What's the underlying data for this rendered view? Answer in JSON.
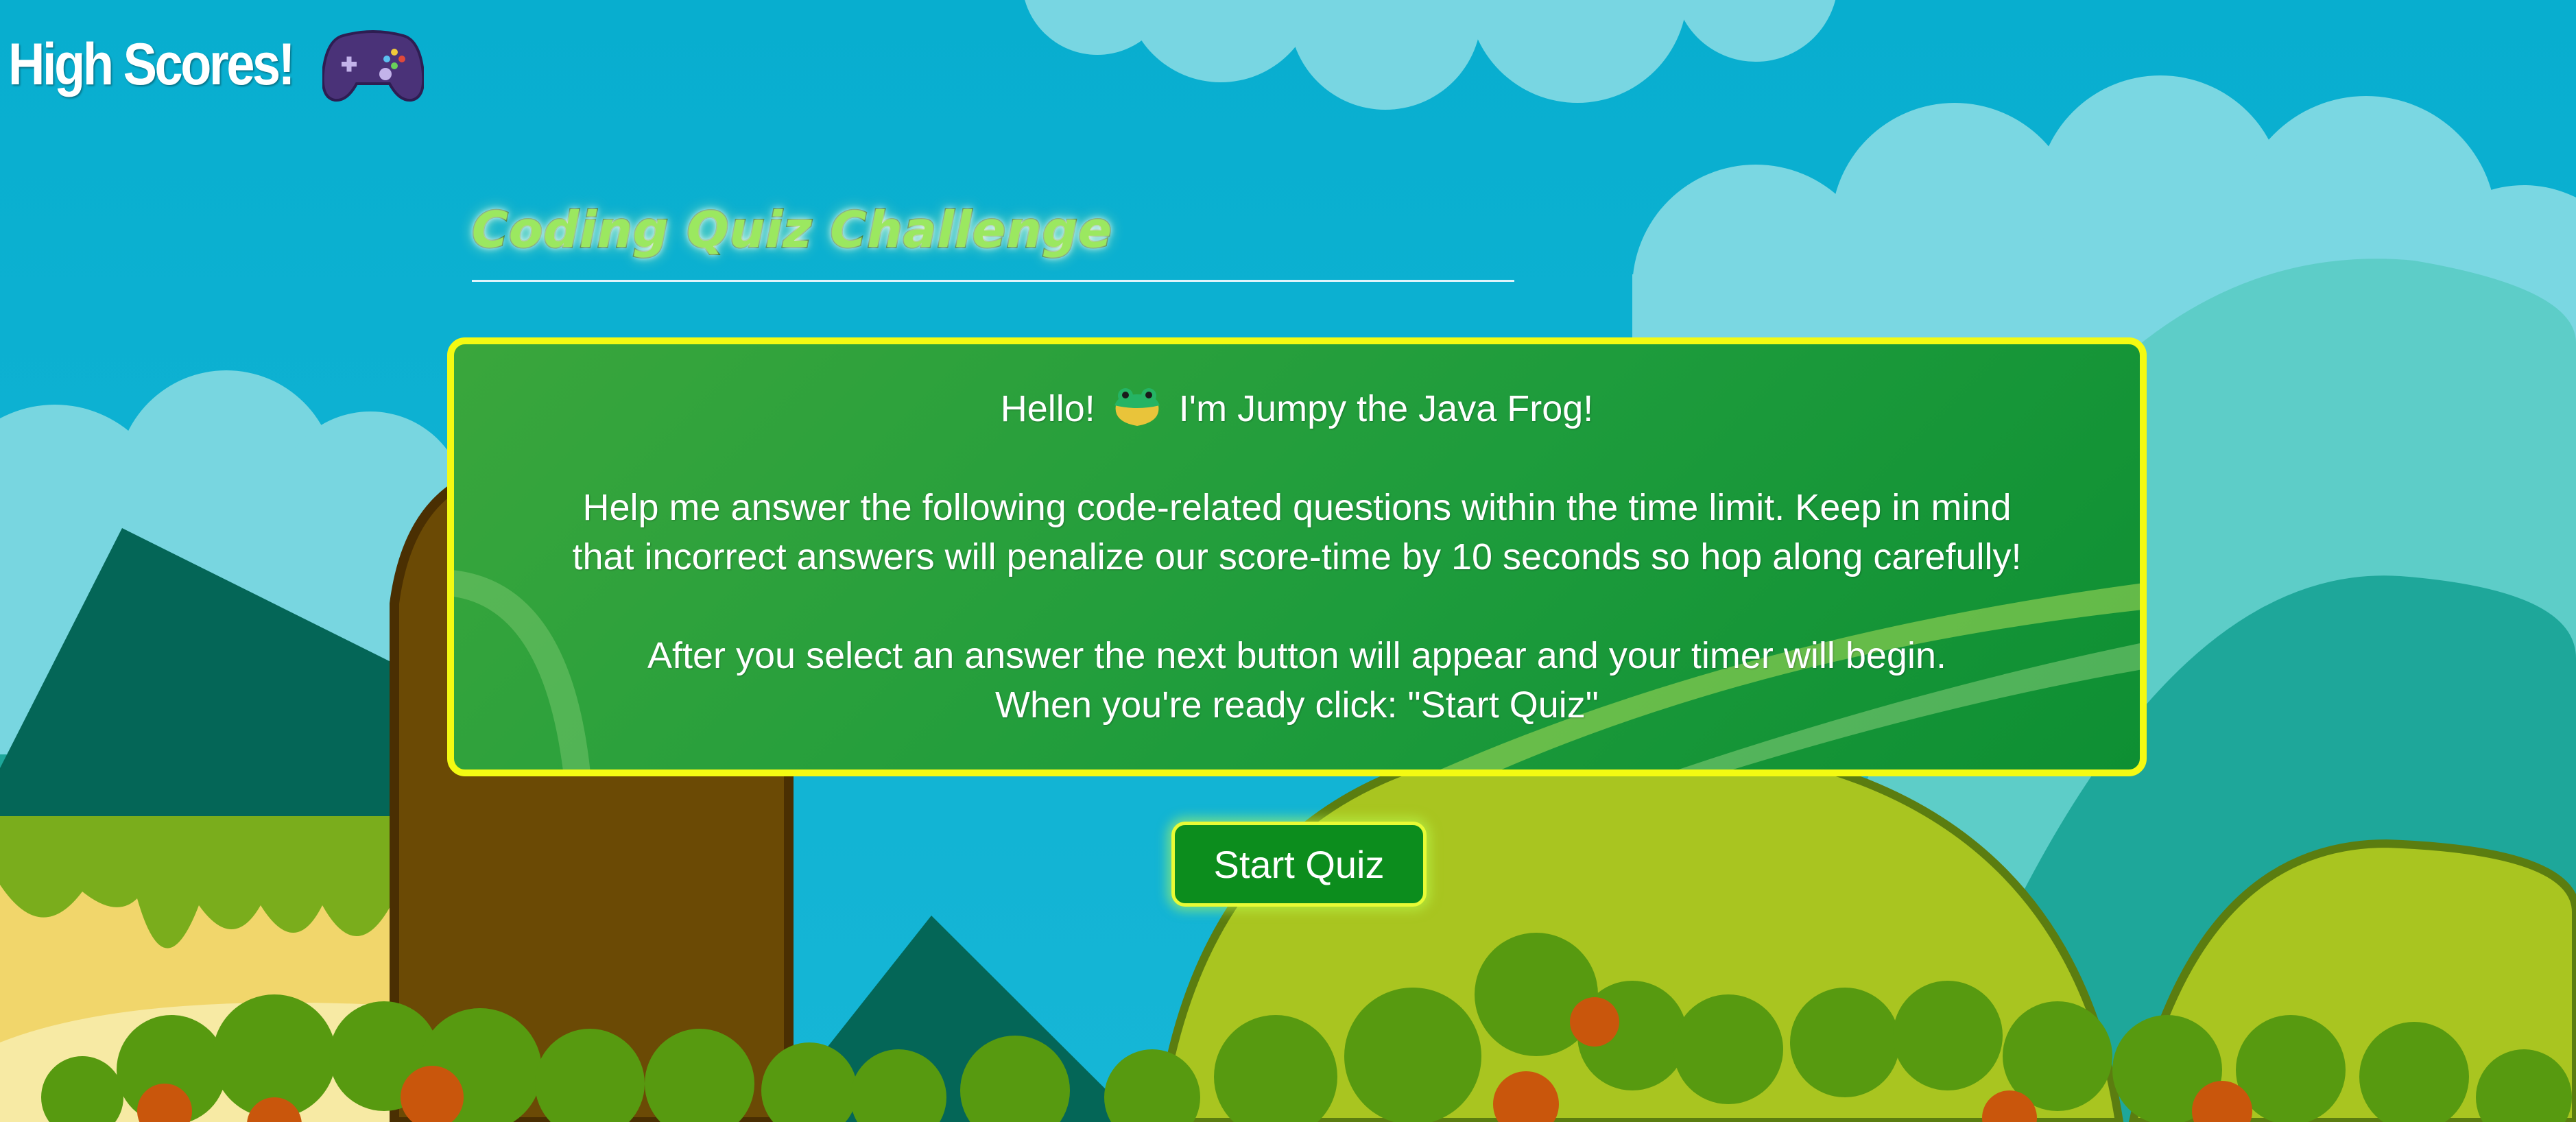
{
  "nav": {
    "high_scores_label": "High Scores!",
    "gamepad_icon": "gamepad-icon"
  },
  "title": "Coding Quiz Challenge",
  "intro": {
    "greeting_before": "Hello!",
    "greeting_after": "I'm Jumpy the Java Frog!",
    "frog_icon": "frog-icon",
    "rules_line1": "Help me answer the following code-related questions within the time limit. Keep in mind",
    "rules_line2": "that incorrect answers will penalize our score-time by 10 seconds so hop along carefully!",
    "instructions_line1": "After you select an answer the next button will appear and your timer will begin.",
    "instructions_line2": "When you're ready click: \"Start Quiz\""
  },
  "start_button": "Start Quiz",
  "colors": {
    "sky": "#0aaed0",
    "card_border": "#f4fa12",
    "card_green": "#1e9c3c",
    "button_green": "#0c8d1d",
    "title_green": "#9be860"
  }
}
